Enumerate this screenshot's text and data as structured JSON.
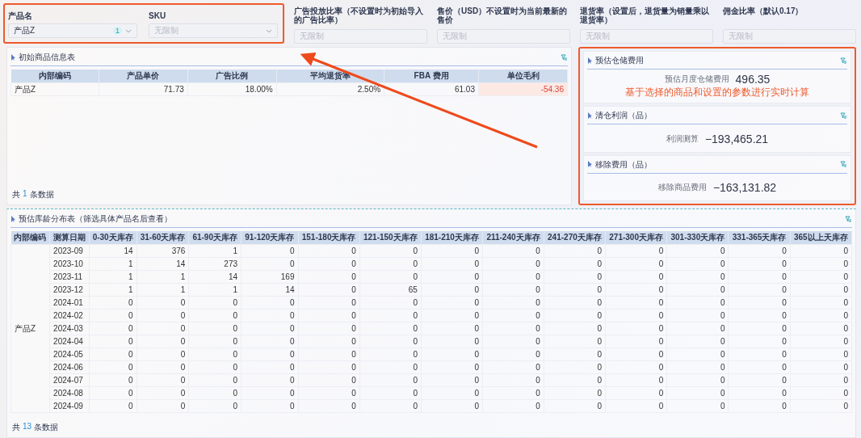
{
  "filters": [
    {
      "kind": "select",
      "label": "产品名",
      "value": "产品Z",
      "badge": "1"
    },
    {
      "kind": "select",
      "label": "SKU",
      "placeholder": "无限制"
    },
    {
      "kind": "input",
      "label": "广告投放比率（不设置时为初始导入的广告比率）",
      "placeholder": "无限制"
    },
    {
      "kind": "input",
      "label": "售价（USD）不设置时为当前最新的售价",
      "placeholder": "无限制"
    },
    {
      "kind": "input",
      "label": "退货率（设置后，退货量为销量乘以退货率）",
      "placeholder": "无限制"
    },
    {
      "kind": "input",
      "label": "佣金比率（默认0.17）",
      "placeholder": "无限制"
    }
  ],
  "product_info": {
    "title": "初始商品信息表",
    "columns": [
      "内部编码",
      "产品单价",
      "广告比例",
      "平均退货率",
      "FBA 费用",
      "单位毛利"
    ],
    "rows": [
      {
        "cells": [
          {
            "text": "产品Z",
            "negative": false
          },
          {
            "text": "71.73",
            "negative": false
          },
          {
            "text": "18.00%",
            "negative": false
          },
          {
            "text": "2.50%",
            "negative": false
          },
          {
            "text": "61.03",
            "negative": false
          },
          {
            "text": "-54.36",
            "negative": true
          }
        ]
      }
    ],
    "footer": {
      "prefix": "共",
      "count": "1",
      "suffix": "条数据"
    }
  },
  "metric_cards": [
    {
      "title": "预估仓储费用",
      "label": "预估月度仓储费用",
      "value": "496.35"
    },
    {
      "title": "清仓利润（品）",
      "label": "利润测算",
      "value": "−193,465.21"
    },
    {
      "title": "移除费用（品）",
      "label": "移除商品费用",
      "value": "−163,131.82"
    }
  ],
  "annotation": {
    "text": "基于选择的商品和设置的参数进行实时计算"
  },
  "age_table": {
    "title": "预估库龄分布表（筛选具体产品名后查看）",
    "columns": [
      "内部编码",
      "测算日期",
      "0-30天库存",
      "31-60天库存",
      "61-90天库存",
      "91-120天库存",
      "151-180天库存",
      "121-150天库存",
      "181-210天库存",
      "211-240天库存",
      "241-270天库存",
      "271-300天库存",
      "301-330天库存",
      "331-365天库存",
      "365以上天库存"
    ],
    "group": "产品Z",
    "rows": [
      {
        "date": "2023-09",
        "values": [
          "14",
          "376",
          "1",
          "0",
          "0",
          "0",
          "0",
          "0",
          "0",
          "0",
          "0",
          "0",
          "0"
        ]
      },
      {
        "date": "2023-10",
        "values": [
          "1",
          "14",
          "273",
          "0",
          "0",
          "0",
          "0",
          "0",
          "0",
          "0",
          "0",
          "0",
          "0"
        ]
      },
      {
        "date": "2023-11",
        "values": [
          "1",
          "1",
          "14",
          "169",
          "0",
          "0",
          "0",
          "0",
          "0",
          "0",
          "0",
          "0",
          "0"
        ]
      },
      {
        "date": "2023-12",
        "values": [
          "1",
          "1",
          "1",
          "14",
          "0",
          "65",
          "0",
          "0",
          "0",
          "0",
          "0",
          "0",
          "0"
        ]
      },
      {
        "date": "2024-01",
        "values": [
          "0",
          "0",
          "0",
          "0",
          "0",
          "0",
          "0",
          "0",
          "0",
          "0",
          "0",
          "0",
          "0"
        ]
      },
      {
        "date": "2024-02",
        "values": [
          "0",
          "0",
          "0",
          "0",
          "0",
          "0",
          "0",
          "0",
          "0",
          "0",
          "0",
          "0",
          "0"
        ]
      },
      {
        "date": "2024-03",
        "values": [
          "0",
          "0",
          "0",
          "0",
          "0",
          "0",
          "0",
          "0",
          "0",
          "0",
          "0",
          "0",
          "0"
        ]
      },
      {
        "date": "2024-04",
        "values": [
          "0",
          "0",
          "0",
          "0",
          "0",
          "0",
          "0",
          "0",
          "0",
          "0",
          "0",
          "0",
          "0"
        ]
      },
      {
        "date": "2024-05",
        "values": [
          "0",
          "0",
          "0",
          "0",
          "0",
          "0",
          "0",
          "0",
          "0",
          "0",
          "0",
          "0",
          "0"
        ]
      },
      {
        "date": "2024-06",
        "values": [
          "0",
          "0",
          "0",
          "0",
          "0",
          "0",
          "0",
          "0",
          "0",
          "0",
          "0",
          "0",
          "0"
        ]
      },
      {
        "date": "2024-07",
        "values": [
          "0",
          "0",
          "0",
          "0",
          "0",
          "0",
          "0",
          "0",
          "0",
          "0",
          "0",
          "0",
          "0"
        ]
      },
      {
        "date": "2024-08",
        "values": [
          "0",
          "0",
          "0",
          "0",
          "0",
          "0",
          "0",
          "0",
          "0",
          "0",
          "0",
          "0",
          "0"
        ]
      },
      {
        "date": "2024-09",
        "values": [
          "0",
          "0",
          "0",
          "0",
          "0",
          "0",
          "0",
          "0",
          "0",
          "0",
          "0",
          "0",
          "0"
        ]
      }
    ],
    "footer": {
      "prefix": "共",
      "count": "13",
      "suffix": "条数据"
    }
  }
}
